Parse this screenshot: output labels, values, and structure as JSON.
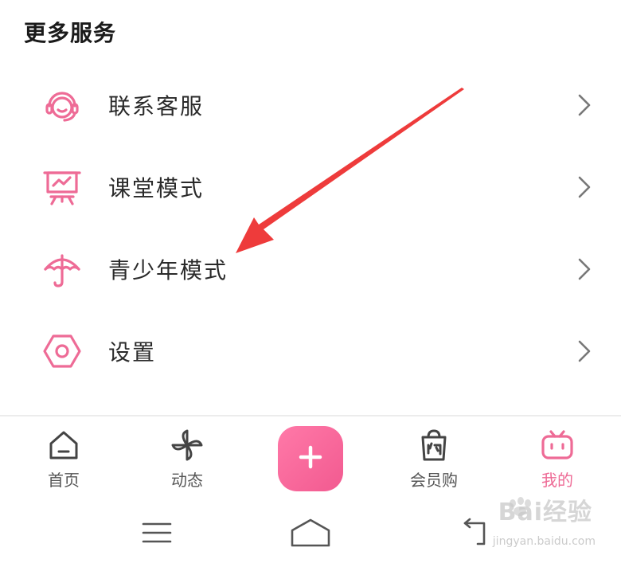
{
  "section": {
    "title": "更多服务"
  },
  "menu": {
    "items": [
      {
        "label": "联系客服",
        "icon": "headset-icon"
      },
      {
        "label": "课堂模式",
        "icon": "presentation-board-icon"
      },
      {
        "label": "青少年模式",
        "icon": "umbrella-icon"
      },
      {
        "label": "设置",
        "icon": "hexagon-settings-icon"
      }
    ]
  },
  "tabbar": {
    "tabs": [
      {
        "label": "首页",
        "icon": "home-icon",
        "active": false
      },
      {
        "label": "动态",
        "icon": "pinwheel-icon",
        "active": false
      },
      {
        "label": "会员购",
        "icon": "shopping-bag-icon",
        "active": false
      },
      {
        "label": "我的",
        "icon": "tv-mascot-icon",
        "active": true
      }
    ],
    "fab_icon": "plus-icon"
  },
  "colors": {
    "accent": "#ee6b96",
    "arrow": "#ee3b3b",
    "text": "#2a2a2a"
  },
  "watermark": {
    "text": "Bai经验",
    "sub": "jingyan.baidu.com"
  }
}
